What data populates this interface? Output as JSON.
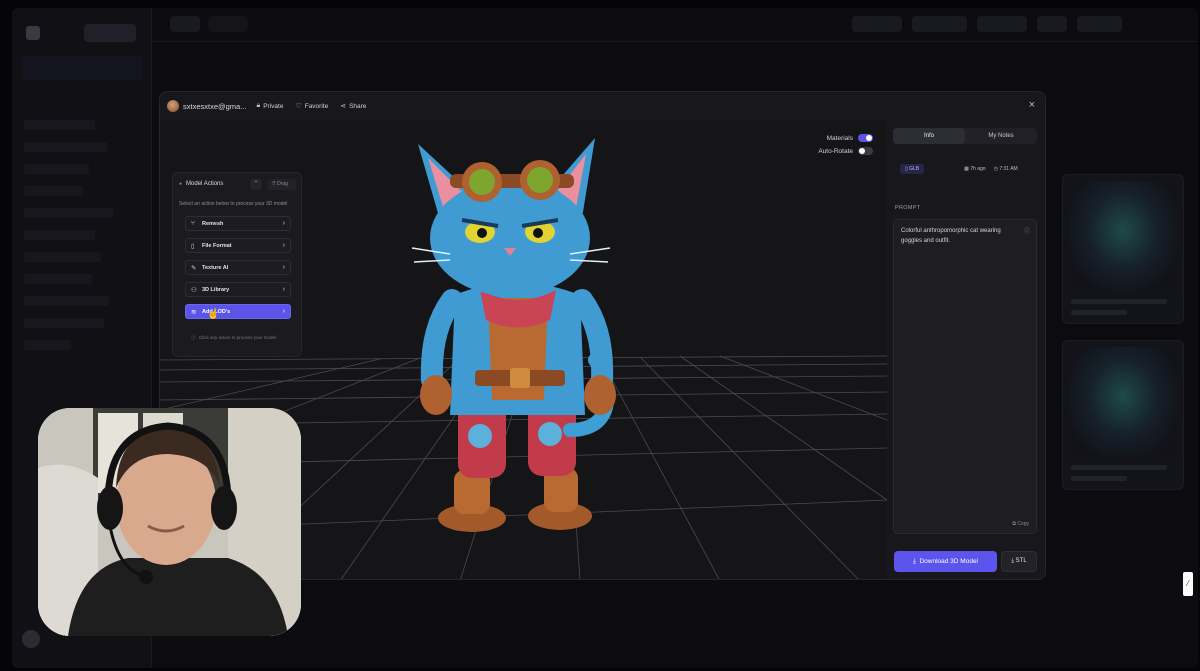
{
  "modal": {
    "user_email": "sxtxesxtxe@gma...",
    "private_label": "Private",
    "favorite_label": "Favorite",
    "share_label": "Share",
    "close_icon": "×"
  },
  "viewer": {
    "materials_label": "Materials",
    "materials_on": true,
    "auto_rotate_label": "Auto-Rotate",
    "auto_rotate_on": false
  },
  "model_actions": {
    "title": "Model Actions",
    "drag_label": "Drag",
    "subtitle": "Select an action below to process your 3D model",
    "items": [
      {
        "icon": "remesh-icon",
        "glyph": "⑂",
        "label": "Remesh"
      },
      {
        "icon": "file-icon",
        "glyph": "▯",
        "label": "File Format"
      },
      {
        "icon": "brush-icon",
        "glyph": "✎",
        "label": "Texture AI"
      },
      {
        "icon": "library-icon",
        "glyph": "⚇",
        "label": "3D Library"
      },
      {
        "icon": "layers-icon",
        "glyph": "≋",
        "label": "Add LOD's",
        "active": true
      }
    ],
    "hint": "Click any action to process your model"
  },
  "panel": {
    "tab_info": "Info",
    "tab_notes": "My Notes",
    "format_badge": "GLB",
    "time_ago": "7h ago",
    "time": "7:31 AM",
    "prompt_label": "PROMPT",
    "prompt_text": "Colorful anthropomorphic cat wearing goggles and outfit.",
    "copy_label": "Copy",
    "download_label": "Download 3D Model",
    "stl_label": "STL"
  },
  "colors": {
    "accent": "#5b55ee",
    "background": "#18181c"
  }
}
